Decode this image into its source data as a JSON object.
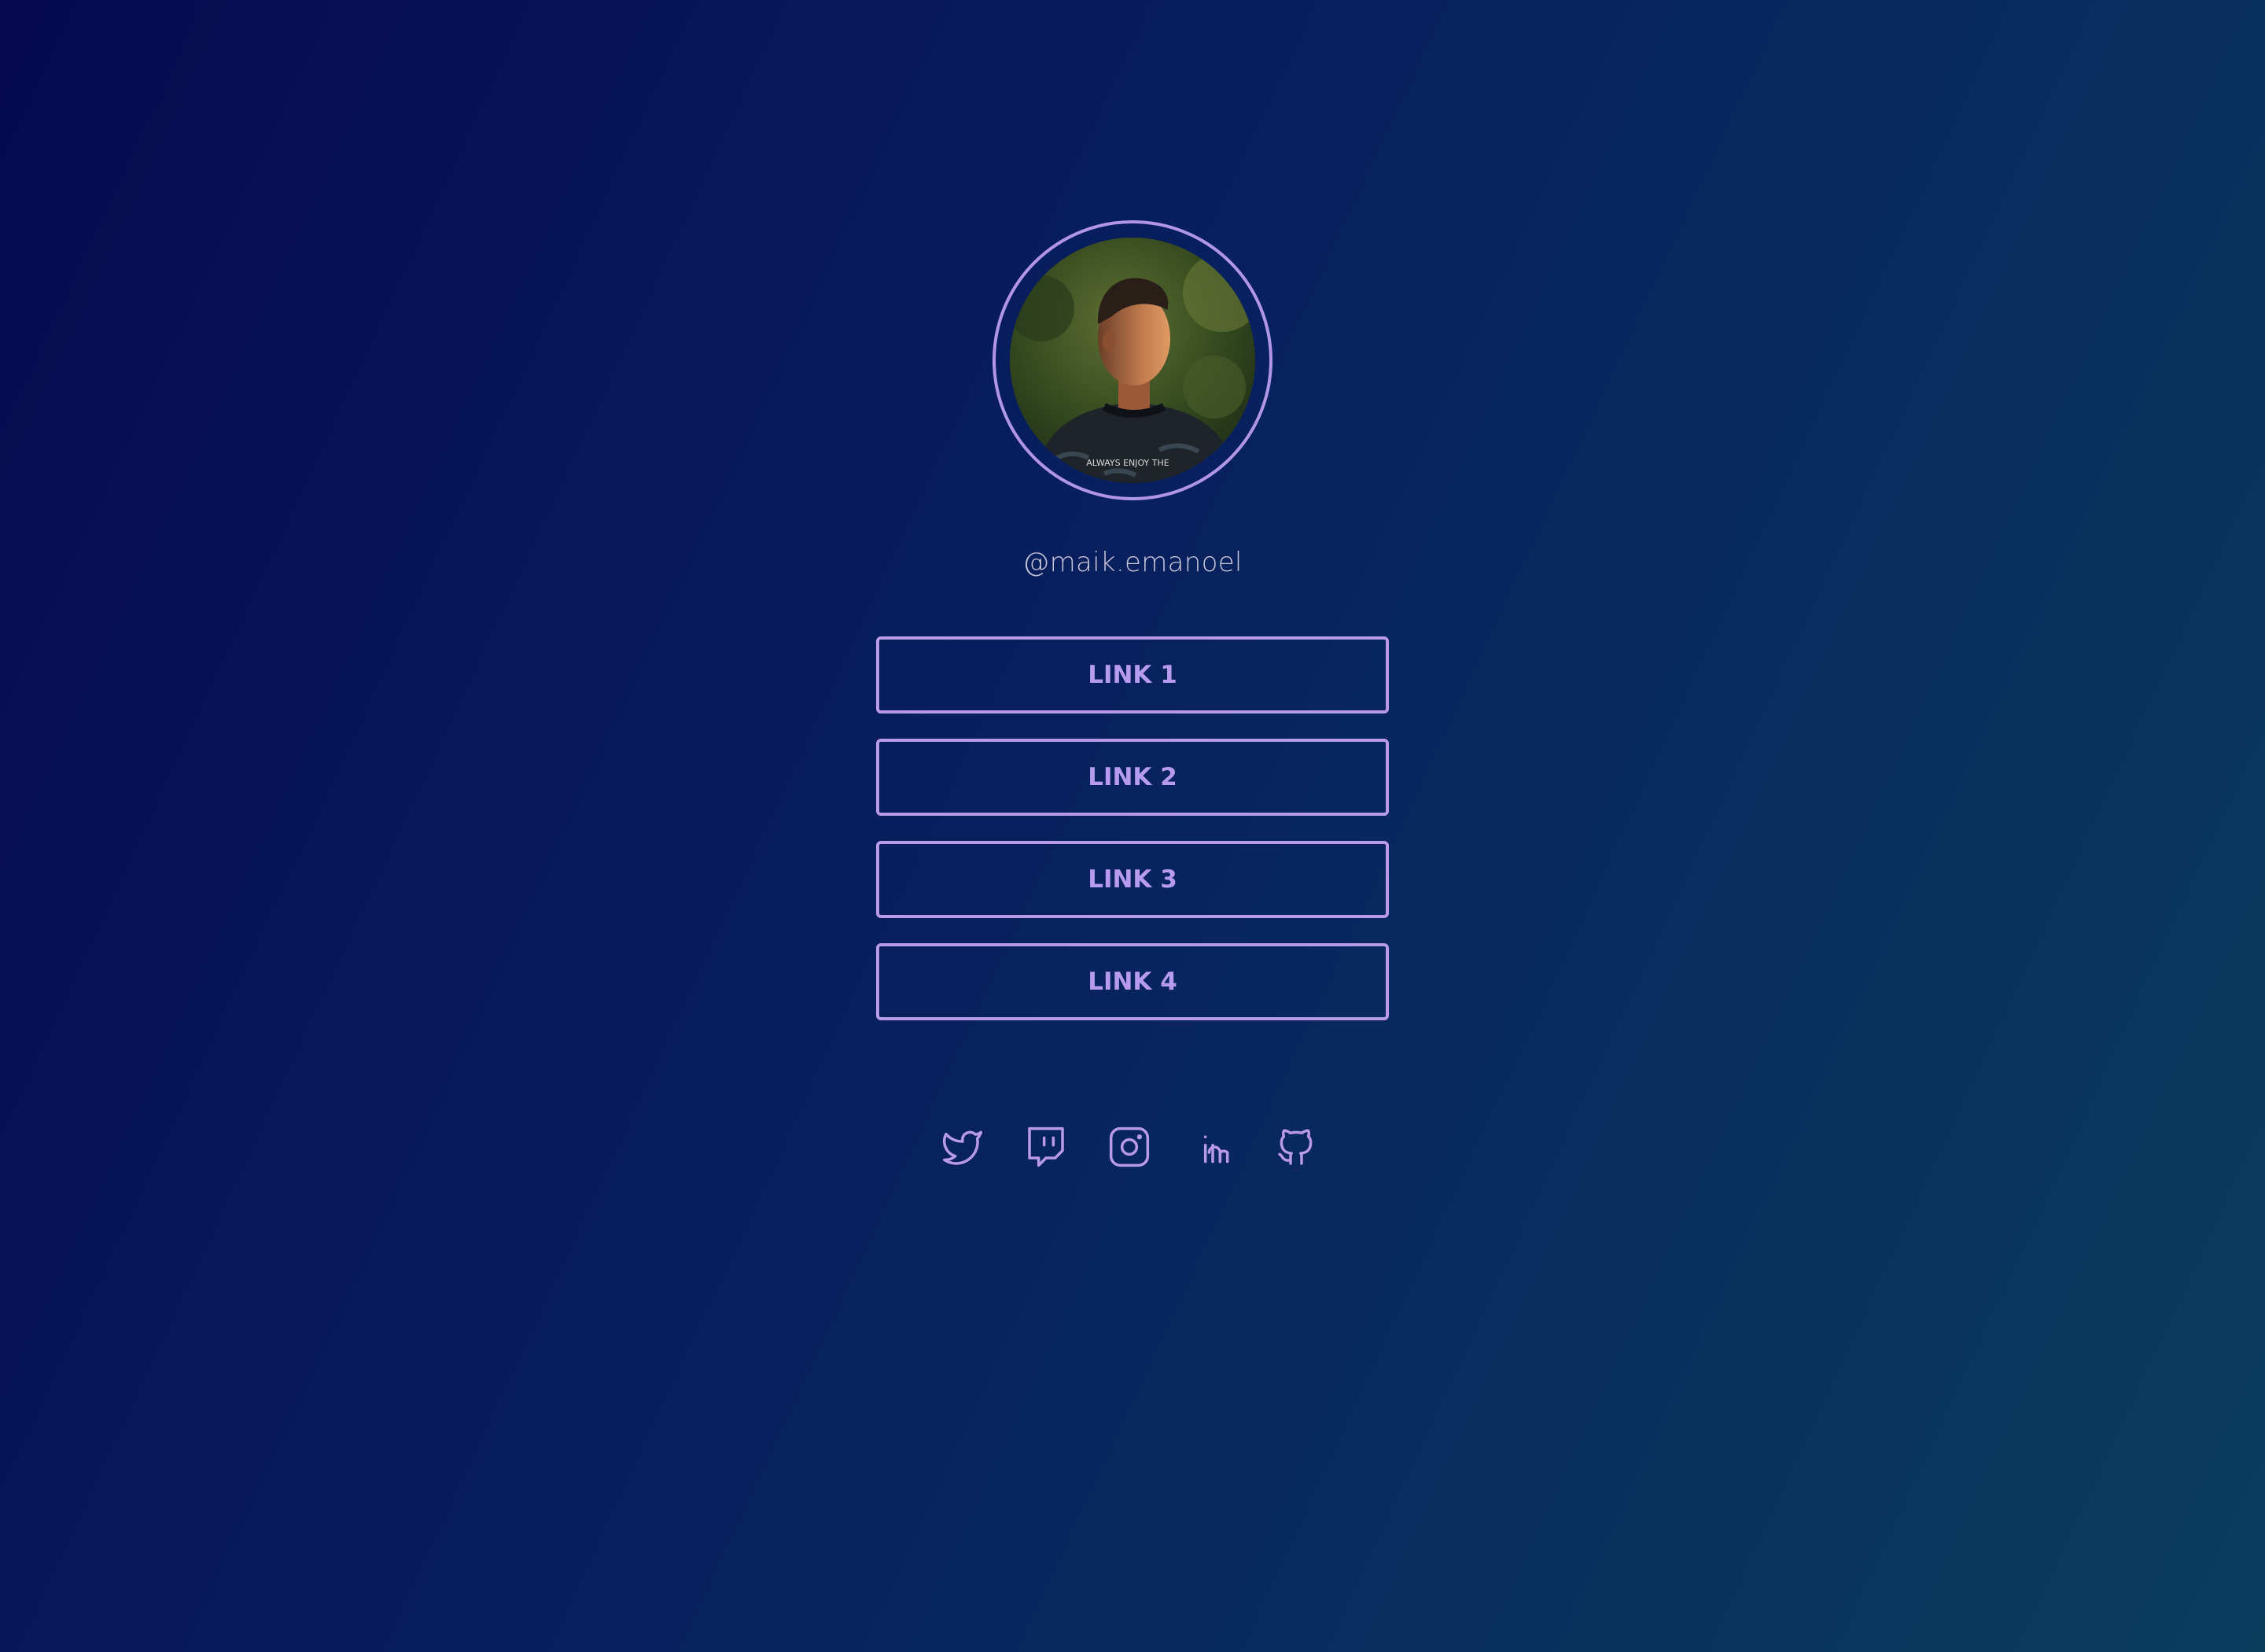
{
  "profile": {
    "username": "@maik.emanoel",
    "avatar_alt": "profile-photo",
    "shirt_text": "ALWAYS ENJOY THE"
  },
  "links": [
    {
      "label": "LINK 1"
    },
    {
      "label": "LINK 2"
    },
    {
      "label": "LINK 3"
    },
    {
      "label": "LINK 4"
    }
  ],
  "socials": [
    {
      "icon": "twitter-icon"
    },
    {
      "icon": "twitch-icon"
    },
    {
      "icon": "instagram-icon"
    },
    {
      "icon": "linkedin-icon"
    },
    {
      "icon": "github-icon"
    }
  ],
  "colors": {
    "background_start": "#050a4e",
    "background_end": "#093d5e",
    "accent": "#b89ae8",
    "username_text": "#c7c6d8"
  }
}
